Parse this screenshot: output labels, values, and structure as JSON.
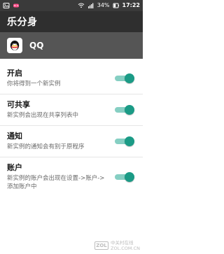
{
  "status_bar": {
    "battery_text": "34%",
    "time_text": "17:22",
    "icons": [
      "gallery-icon",
      "gamepad-icon",
      "wifi-icon",
      "signal-icon",
      "battery-icon"
    ]
  },
  "appbar": {
    "title": "乐分身"
  },
  "app": {
    "name": "QQ"
  },
  "settings": [
    {
      "title": "开启",
      "desc": "你将得到一个新实例",
      "enabled": true
    },
    {
      "title": "可共享",
      "desc": "新实例会出现在共享列表中",
      "enabled": true
    },
    {
      "title": "通知",
      "desc": "新实例的通知会有别于原程序",
      "enabled": true
    },
    {
      "title": "账户",
      "desc": "新实例的账户会出现在设置->账户->添加账户中",
      "enabled": true
    }
  ],
  "watermark": {
    "logo_text": "ZOL",
    "line1": "中关村在线",
    "line2": "ZOL.COM.CN"
  },
  "colors": {
    "status_bar_bg": "#3a3a3a",
    "appbar_bg": "#2f2f2f",
    "header_bg": "#555555",
    "toggle_track": "#86cfc3",
    "toggle_thumb": "#1b9b86"
  }
}
